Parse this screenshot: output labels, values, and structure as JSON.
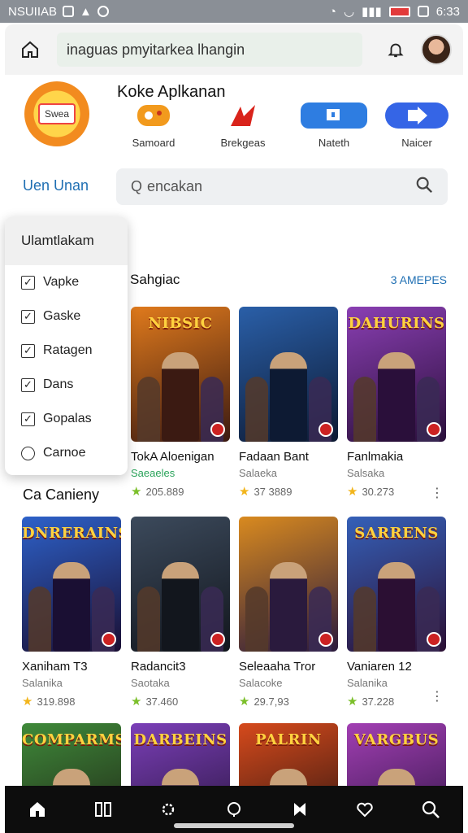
{
  "status_bar": {
    "carrier": "NSUIIAB",
    "time": "6:33"
  },
  "top_bar": {
    "url_text": "inaguas pmyitarkea lhangin"
  },
  "app": {
    "title": "Koke Aplkanan",
    "logo_text": "Swea"
  },
  "actions": [
    {
      "label": "Samoard",
      "icon": "chat-bubble-icon"
    },
    {
      "label": "Brekgeas",
      "icon": "red-arrow-icon"
    },
    {
      "label": "Nateth",
      "icon": "blue-window-icon"
    },
    {
      "label": "Naicer",
      "icon": "blue-play-icon"
    }
  ],
  "section_link": "Uen Unan",
  "search": {
    "value": "encakan"
  },
  "dropdown": {
    "header": "Ulamtlakam",
    "items": [
      {
        "label": "Vapke",
        "control": "checkbox"
      },
      {
        "label": "Gaske",
        "control": "checkbox"
      },
      {
        "label": "Ratagen",
        "control": "checkbox"
      },
      {
        "label": "Dans",
        "control": "checkbox"
      },
      {
        "label": "Gopalas",
        "control": "checkbox"
      },
      {
        "label": "Carnoe",
        "control": "radio"
      }
    ]
  },
  "shelf": {
    "title": "Sahgiac",
    "see_all": "3 AMEPES"
  },
  "category_title": "Ca Canieny",
  "row1": [
    {
      "cover_title": "NIBSIC",
      "title": "TokA Aloenigan",
      "subtitle": "Saeaeles",
      "subtitle_green": true,
      "rating": "205.889",
      "star_color": "green",
      "colors": [
        "#e07a1c",
        "#3b1a12"
      ]
    },
    {
      "cover_title": "",
      "title": "Fadaan Bant",
      "subtitle": "Salaeka",
      "subtitle_green": false,
      "rating": "37 3889",
      "star_color": "gold",
      "colors": [
        "#2a5fa8",
        "#0d1a33"
      ]
    },
    {
      "cover_title": "DAHURINS",
      "title": "Fanlmakia",
      "subtitle": "Salsaka",
      "subtitle_green": false,
      "rating": "30.273",
      "star_color": "gold",
      "colors": [
        "#8a3fb3",
        "#2a0f3a"
      ]
    }
  ],
  "row2": [
    {
      "cover_title": "DNRERAINS",
      "title": "Xaniham T3",
      "subtitle": "Salanika",
      "rating": "319.898",
      "star_color": "gold",
      "colors": [
        "#2d61c9",
        "#1a0f33"
      ]
    },
    {
      "cover_title": "",
      "title": "Radancit3",
      "subtitle": "Saotaka",
      "rating": "37.460",
      "star_color": "green",
      "colors": [
        "#3c4a5c",
        "#12161d"
      ]
    },
    {
      "cover_title": "",
      "title": "Seleaaha Tror",
      "subtitle": "Salacoke",
      "rating": "29.7,93",
      "star_color": "green",
      "colors": [
        "#d98a1f",
        "#2a1a3d"
      ]
    },
    {
      "cover_title": "SARRENS",
      "title": "Vaniaren 12",
      "subtitle": "Salanika",
      "rating": "37.228",
      "star_color": "green",
      "colors": [
        "#3560b8",
        "#2b0f33"
      ]
    }
  ],
  "row3": [
    {
      "cover_title": "COMPARMS",
      "colors": [
        "#3f8a3a",
        "#1c1a12"
      ]
    },
    {
      "cover_title": "DARBEINS",
      "colors": [
        "#7b3fb8",
        "#1f1030"
      ]
    },
    {
      "cover_title": "PALRIN",
      "colors": [
        "#d64a1c",
        "#1a0f0f"
      ]
    },
    {
      "cover_title": "VARGBUS",
      "colors": [
        "#a23fb3",
        "#23103a"
      ]
    }
  ]
}
